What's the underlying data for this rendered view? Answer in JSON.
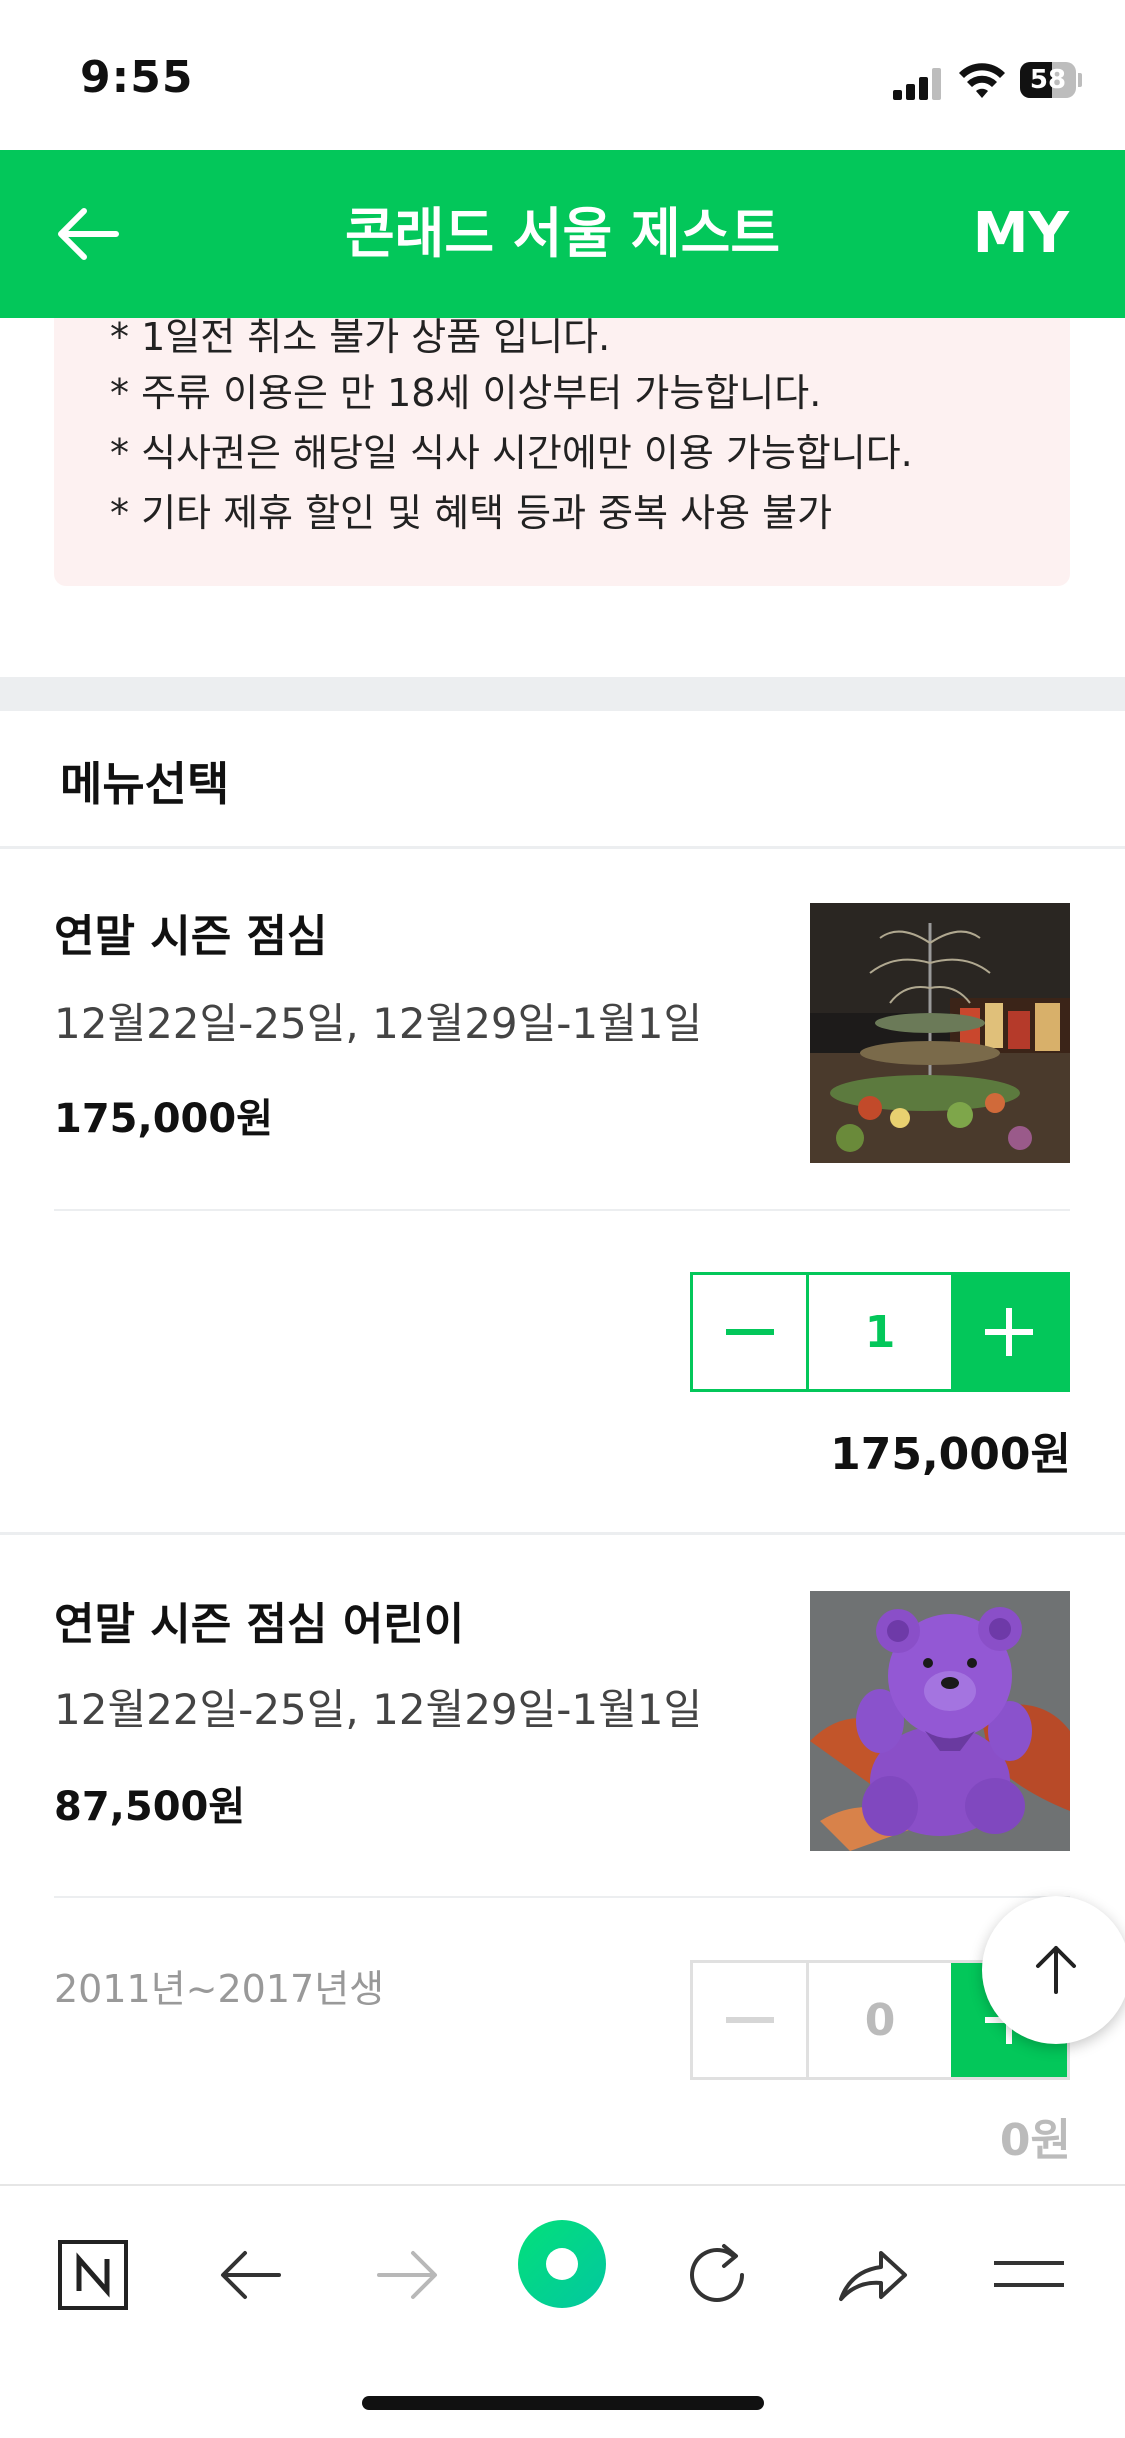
{
  "status_bar": {
    "time": "9:55",
    "battery": "58",
    "battery_level": 0.58
  },
  "header": {
    "title": "콘래드 서울 제스트",
    "my_label": "MY"
  },
  "notice": {
    "lines": [
      "* 1일전 취소 불가 상품 입니다.",
      "* 주류 이용은 만 18세 이상부터 가능합니다.",
      "* 식사권은 해당일 식사 시간에만 이용 가능합니다.",
      "* 기타 제휴 할인 및 혜택 등과 중복 사용 불가"
    ]
  },
  "menu_section": {
    "title": "메뉴선택",
    "items": [
      {
        "name": "연말 시즌 점심",
        "dates": "12월22일-25일, 12월29일-1월1일",
        "price": "175,000원",
        "quantity": "1",
        "line_total": "175,000원",
        "age_note": ""
      },
      {
        "name": "연말 시즌 점심 어린이",
        "dates": "12월22일-25일, 12월29일-1월1일",
        "price": "87,500원",
        "quantity": "0",
        "line_total": "0원",
        "age_note": "2011년~2017년생"
      }
    ]
  },
  "colors": {
    "brand": "#03c75a",
    "notice_bg": "#fdf1f1",
    "divider": "#eceef0"
  },
  "toolbar": {
    "icons": [
      "naver-n-icon",
      "back-arrow-icon",
      "forward-arrow-icon",
      "green-dot-icon",
      "reload-icon",
      "share-icon",
      "menu-icon"
    ]
  }
}
